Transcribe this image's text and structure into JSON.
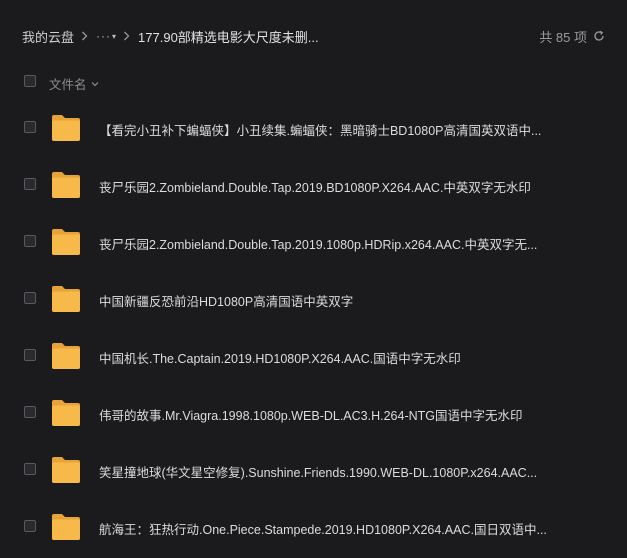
{
  "breadcrumb": {
    "root": "我的云盘",
    "more": "···",
    "current": "177.90部精选电影大尺度未删..."
  },
  "count_label": "共 85 项",
  "header": {
    "column_name": "文件名"
  },
  "files": [
    {
      "name": "【看完小丑补下蝙蝠侠】小丑续集.蝙蝠侠：黑暗骑士BD1080P高清国英双语中..."
    },
    {
      "name": "丧尸乐园2.Zombieland.Double.Tap.2019.BD1080P.X264.AAC.中英双字无水印"
    },
    {
      "name": "丧尸乐园2.Zombieland.Double.Tap.2019.1080p.HDRip.x264.AAC.中英双字无..."
    },
    {
      "name": "中国新疆反恐前沿HD1080P高清国语中英双字"
    },
    {
      "name": "中国机长.The.Captain.2019.HD1080P.X264.AAC.国语中字无水印"
    },
    {
      "name": "伟哥的故事.Mr.Viagra.1998.1080p.WEB-DL.AC3.H.264-NTG国语中字无水印"
    },
    {
      "name": "笑星撞地球(华文星空修复).Sunshine.Friends.1990.WEB-DL.1080P.x264.AAC..."
    },
    {
      "name": "航海王：狂热行动.One.Piece.Stampede.2019.HD1080P.X264.AAC.国日双语中..."
    }
  ],
  "colors": {
    "background": "#1b1b1e",
    "folder": "#f7b94a",
    "folder_back": "#e8a23a"
  }
}
